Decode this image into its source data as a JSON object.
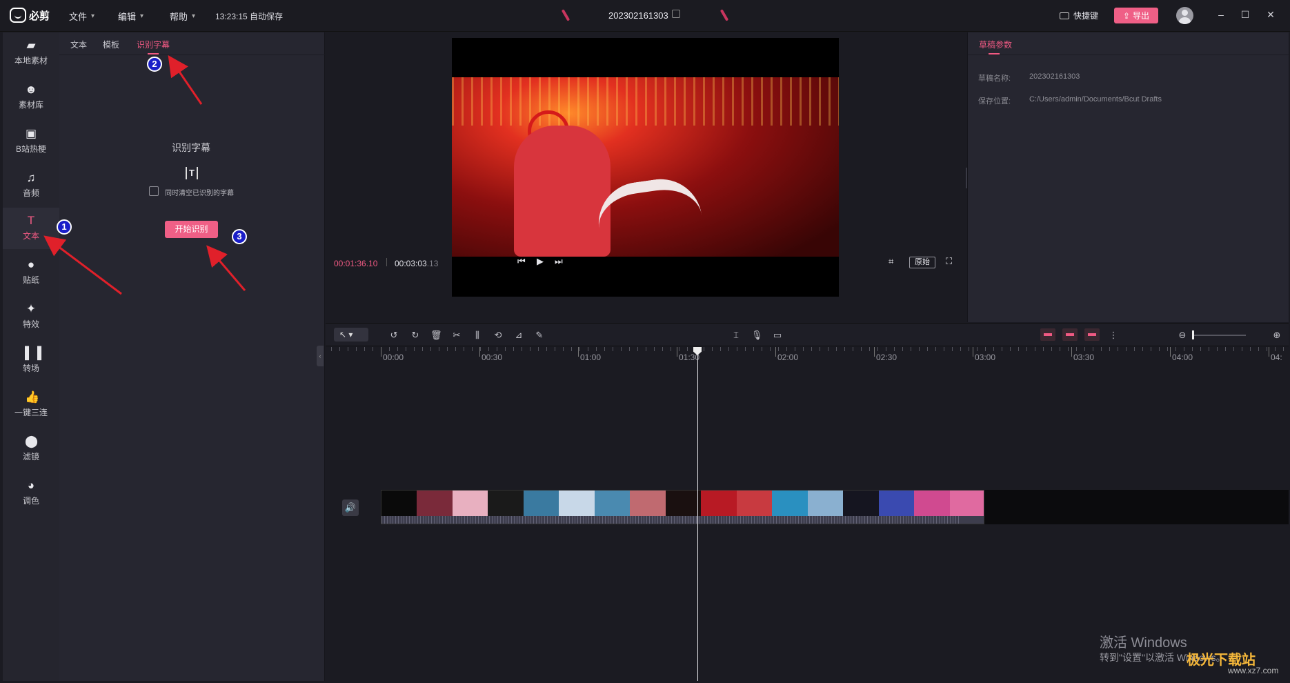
{
  "app": {
    "logo_text": "必剪",
    "menus": [
      "文件",
      "编辑",
      "帮助"
    ],
    "autosave": "13:23:15 自动保存",
    "project_name": "202302161303",
    "shortcut_label": "快捷键",
    "export_label": "导出"
  },
  "sidebar": {
    "items": [
      {
        "label": "本地素材",
        "icon": "folder-icon"
      },
      {
        "label": "素材库",
        "icon": "library-icon"
      },
      {
        "label": "B站热梗",
        "icon": "bilibili-icon"
      },
      {
        "label": "音频",
        "icon": "music-icon"
      },
      {
        "label": "文本",
        "icon": "text-icon"
      },
      {
        "label": "贴纸",
        "icon": "sticker-icon"
      },
      {
        "label": "特效",
        "icon": "effects-icon"
      },
      {
        "label": "转场",
        "icon": "transition-icon"
      },
      {
        "label": "一键三连",
        "icon": "like-icon"
      },
      {
        "label": "滤镜",
        "icon": "filter-icon"
      },
      {
        "label": "调色",
        "icon": "palette-icon"
      }
    ],
    "active": "文本"
  },
  "text_panel": {
    "tabs": [
      "文本",
      "模板",
      "识别字幕"
    ],
    "active_tab": "识别字幕",
    "title": "识别字幕",
    "checkbox_label": "同时清空已识别的字幕",
    "start_button": "开始识别"
  },
  "annotations": [
    "1",
    "2",
    "3"
  ],
  "preview": {
    "current_time": "00:01:36.10",
    "total_time": "00:03:03",
    "total_frames": ".13",
    "ratio_label": "原始"
  },
  "props": {
    "tab": "草稿参数",
    "name_label": "草稿名称:",
    "name_value": "202302161303",
    "path_label": "保存位置:",
    "path_value": "C:/Users/admin/Documents/Bcut Drafts"
  },
  "timeline": {
    "ticks": [
      "00:00",
      "00:30",
      "01:00",
      "01:30",
      "02:00",
      "02:30",
      "03:00",
      "03:30",
      "04:00",
      "04:"
    ]
  },
  "watermark": {
    "line1": "激活 Windows",
    "line2": "转到\"设置\"以激活 Windows。",
    "site": "极光下载站",
    "url": "www.xz7.com"
  },
  "colors": {
    "accent": "#f05a83",
    "background": "#1b1b22",
    "panel": "#262630"
  }
}
